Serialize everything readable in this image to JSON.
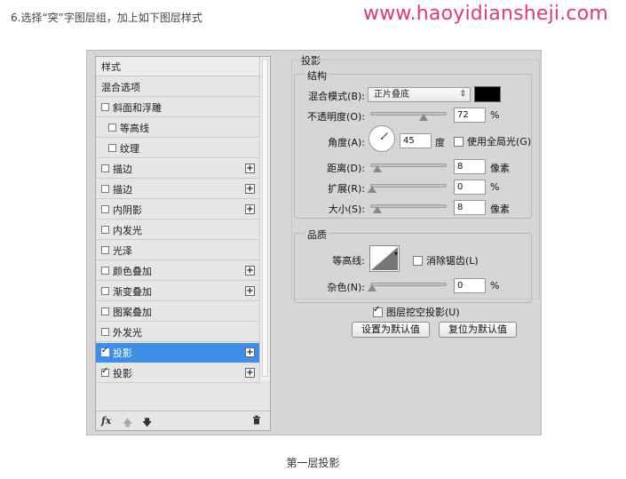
{
  "header": {
    "step_title": "6.选择“突”字图层组，加上如下图层样式",
    "watermark": "www.haoyidiansheji.com"
  },
  "caption": "第一层投影",
  "style_list": {
    "items": [
      {
        "label": "样式",
        "checkbox": false,
        "checked": false,
        "plus": false,
        "indent": false,
        "selected": false,
        "header": true
      },
      {
        "label": "混合选项",
        "checkbox": false,
        "checked": false,
        "plus": false,
        "indent": false,
        "selected": false,
        "header": false
      },
      {
        "label": "斜面和浮雕",
        "checkbox": true,
        "checked": false,
        "plus": false,
        "indent": false,
        "selected": false,
        "header": false
      },
      {
        "label": "等高线",
        "checkbox": true,
        "checked": false,
        "plus": false,
        "indent": true,
        "selected": false,
        "header": false
      },
      {
        "label": "纹理",
        "checkbox": true,
        "checked": false,
        "plus": false,
        "indent": true,
        "selected": false,
        "header": false
      },
      {
        "label": "描边",
        "checkbox": true,
        "checked": false,
        "plus": true,
        "indent": false,
        "selected": false,
        "header": false
      },
      {
        "label": "描边",
        "checkbox": true,
        "checked": false,
        "plus": true,
        "indent": false,
        "selected": false,
        "header": false
      },
      {
        "label": "内阴影",
        "checkbox": true,
        "checked": false,
        "plus": true,
        "indent": false,
        "selected": false,
        "header": false
      },
      {
        "label": "内发光",
        "checkbox": true,
        "checked": false,
        "plus": false,
        "indent": false,
        "selected": false,
        "header": false
      },
      {
        "label": "光泽",
        "checkbox": true,
        "checked": false,
        "plus": false,
        "indent": false,
        "selected": false,
        "header": false
      },
      {
        "label": "颜色叠加",
        "checkbox": true,
        "checked": false,
        "plus": true,
        "indent": false,
        "selected": false,
        "header": false
      },
      {
        "label": "渐变叠加",
        "checkbox": true,
        "checked": false,
        "plus": true,
        "indent": false,
        "selected": false,
        "header": false
      },
      {
        "label": "图案叠加",
        "checkbox": true,
        "checked": false,
        "plus": false,
        "indent": false,
        "selected": false,
        "header": false
      },
      {
        "label": "外发光",
        "checkbox": true,
        "checked": false,
        "plus": false,
        "indent": false,
        "selected": false,
        "header": false
      },
      {
        "label": "投影",
        "checkbox": true,
        "checked": true,
        "plus": true,
        "indent": false,
        "selected": true,
        "header": false
      },
      {
        "label": "投影",
        "checkbox": true,
        "checked": true,
        "plus": true,
        "indent": false,
        "selected": false,
        "header": false
      }
    ],
    "footer_icons": [
      "fx-icon",
      "arrow-up-icon",
      "arrow-down-icon",
      "trash-icon"
    ],
    "footer_fx": "fx"
  },
  "drop_shadow": {
    "title": "投影",
    "structure": {
      "legend": "结构",
      "blend_mode_label": "混合模式(B):",
      "blend_mode_value": "正片叠底",
      "shadow_color": "#000000",
      "opacity_label": "不透明度(O):",
      "opacity_value": "72",
      "opacity_unit": "%",
      "angle_label": "角度(A):",
      "angle_value": "45",
      "angle_unit": "度",
      "global_light_label": "使用全局光(G)",
      "global_light_checked": false,
      "distance_label": "距离(D):",
      "distance_value": "8",
      "distance_unit": "像素",
      "spread_label": "扩展(R):",
      "spread_value": "0",
      "spread_unit": "%",
      "size_label": "大小(S):",
      "size_value": "8",
      "size_unit": "像素"
    },
    "quality": {
      "legend": "品质",
      "contour_label": "等高线:",
      "anti_alias_label": "消除锯齿(L)",
      "anti_alias_checked": false,
      "noise_label": "杂色(N):",
      "noise_value": "0",
      "noise_unit": "%"
    },
    "knockout_label": "图层挖空投影(U)",
    "knockout_checked": true,
    "set_default_button": "设置为默认值",
    "reset_default_button": "复位为默认值"
  }
}
